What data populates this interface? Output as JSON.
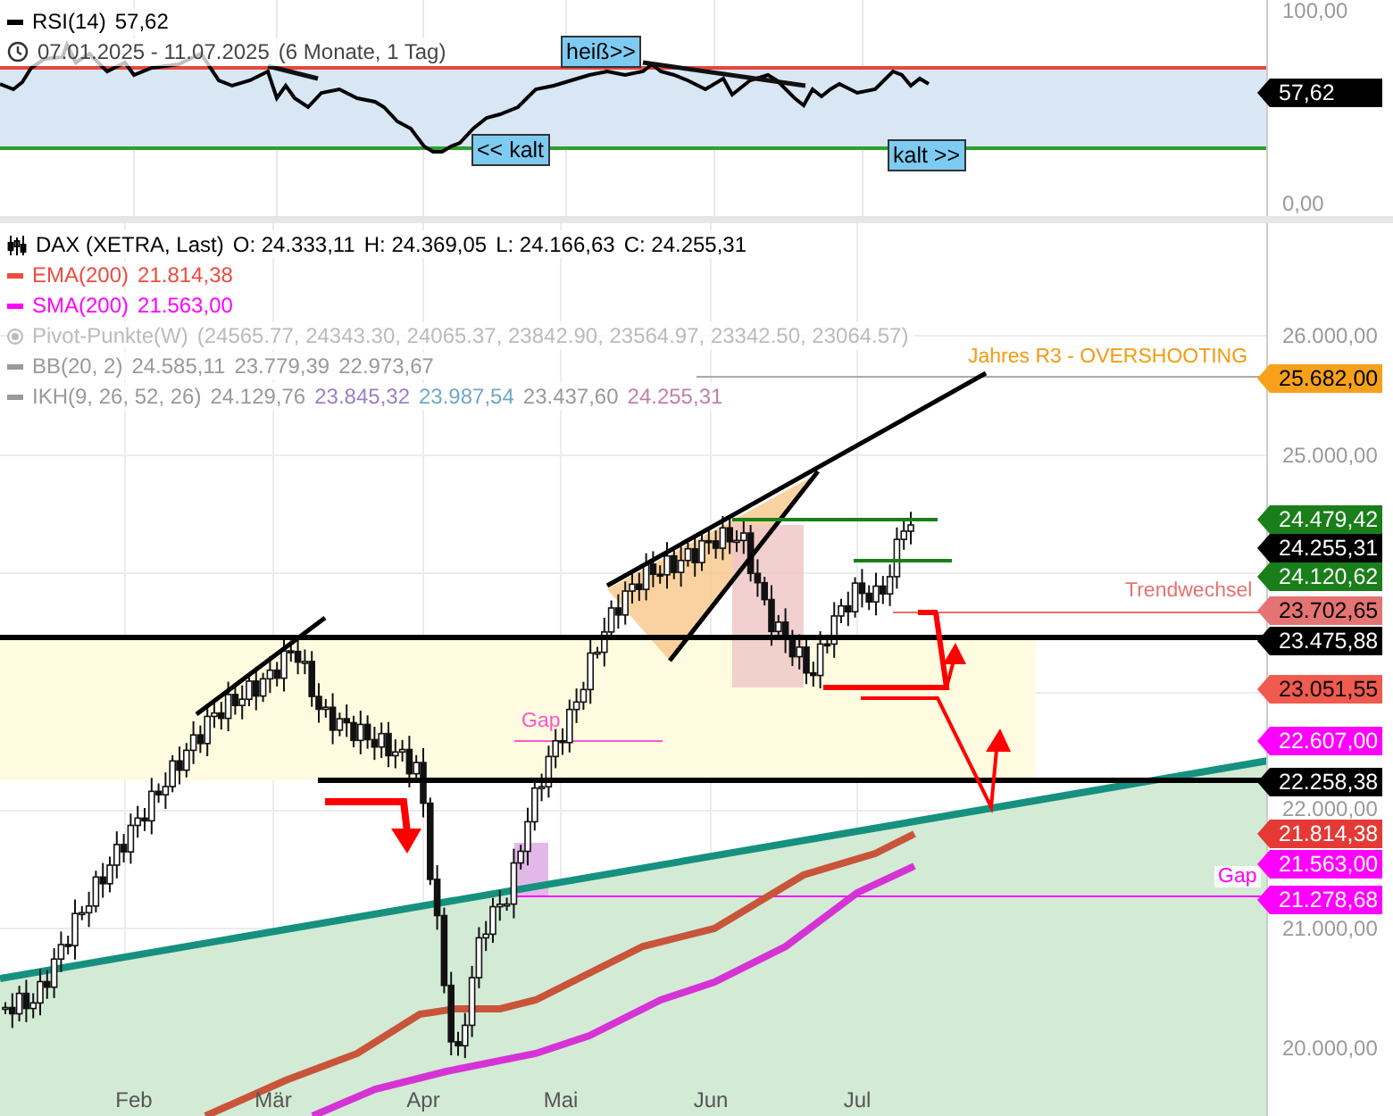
{
  "rsi_panel": {
    "legend": {
      "name": "RSI(14)",
      "value": "57,62"
    },
    "date_range": {
      "range": "07.01.2025 - 11.07.2025",
      "span": "(6 Monate, 1 Tag)"
    },
    "annotations": [
      {
        "text": "heiß>>"
      },
      {
        "text": "<< kalt"
      },
      {
        "text": "kalt >>"
      }
    ],
    "axis_labels": [
      "100,00",
      "0,00"
    ],
    "value_tag": {
      "text": "57,62",
      "color": "#000000"
    }
  },
  "main_panel": {
    "legend": [
      {
        "kind": "candles",
        "color": "#000000",
        "name": "DAX (XETRA, Last)",
        "values": [
          {
            "text": "O: 24.333,11",
            "color": "#000000"
          },
          {
            "text": "H: 24.369,05",
            "color": "#000000"
          },
          {
            "text": "L: 24.166,63",
            "color": "#000000"
          },
          {
            "text": "C: 24.255,31",
            "color": "#000000"
          }
        ]
      },
      {
        "kind": "line",
        "color": "#f04a3e",
        "name": "EMA(200)",
        "values": [
          {
            "text": "21.814,38",
            "color": "#f04a3e"
          }
        ]
      },
      {
        "kind": "line",
        "color": "#ff00ff",
        "name": "SMA(200)",
        "values": [
          {
            "text": "21.563,00",
            "color": "#ff00ff"
          }
        ]
      },
      {
        "kind": "circle",
        "color": "#bbbbbb",
        "name": "Pivot-Punkte(W)",
        "values": [
          {
            "text": "(24565.77,  24343.30,  24065.37,  23842.90,  23564.97,  23342.50,  23064.57)",
            "color": "#bbbbbb"
          }
        ]
      },
      {
        "kind": "line",
        "color": "#999999",
        "name": "BB(20, 2)",
        "values": [
          {
            "text": "24.585,11",
            "color": "#999999"
          },
          {
            "text": "23.779,39",
            "color": "#999999"
          },
          {
            "text": "22.973,67",
            "color": "#999999"
          }
        ]
      },
      {
        "kind": "line",
        "color": "#999999",
        "name": "IKH(9, 26, 52, 26)",
        "values": [
          {
            "text": "24.129,76",
            "color": "#999999"
          },
          {
            "text": "23.845,32",
            "color": "#9a7fc4"
          },
          {
            "text": "23.987,54",
            "color": "#6fa8c4"
          },
          {
            "text": "23.437,60",
            "color": "#999999"
          },
          {
            "text": "24.255,31",
            "color": "#c07fa8"
          }
        ]
      }
    ],
    "annotations": [
      {
        "text": "Jahres R3 - OVERSHOOTING",
        "color": "#f59a0f"
      },
      {
        "text": "Trendwechsel",
        "color": "#e87070"
      },
      {
        "text": "Gap",
        "color": "#ff55cc"
      },
      {
        "text": "Gap",
        "color": "#ff00ff"
      }
    ],
    "axis_labels": [
      "26.000,00",
      "25.000,00",
      "22.000,00",
      "21.000,00",
      "20.000,00"
    ],
    "price_tags": [
      {
        "text": "25.682,00",
        "color": "#f7a11a"
      },
      {
        "text": "24.479,42",
        "color": "#1a7f1a"
      },
      {
        "text": "24.255,31",
        "color": "#000000"
      },
      {
        "text": "24.120,62",
        "color": "#1a7f1a"
      },
      {
        "text": "23.702,65",
        "color": "#e57373"
      },
      {
        "text": "23.475,88",
        "color": "#000000"
      },
      {
        "text": "23.051,55",
        "color": "#f05a4f"
      },
      {
        "text": "22.607,00",
        "color": "#ff00ff"
      },
      {
        "text": "22.258,38",
        "color": "#000000"
      },
      {
        "text": "21.814,38",
        "color": "#e53935"
      },
      {
        "text": "21.563,00",
        "color": "#ff00ff"
      },
      {
        "text": "21.278,68",
        "color": "#ff00ff"
      }
    ],
    "x_axis": [
      "Feb",
      "Mär",
      "Apr",
      "Mai",
      "Jun",
      "Jul"
    ]
  }
}
